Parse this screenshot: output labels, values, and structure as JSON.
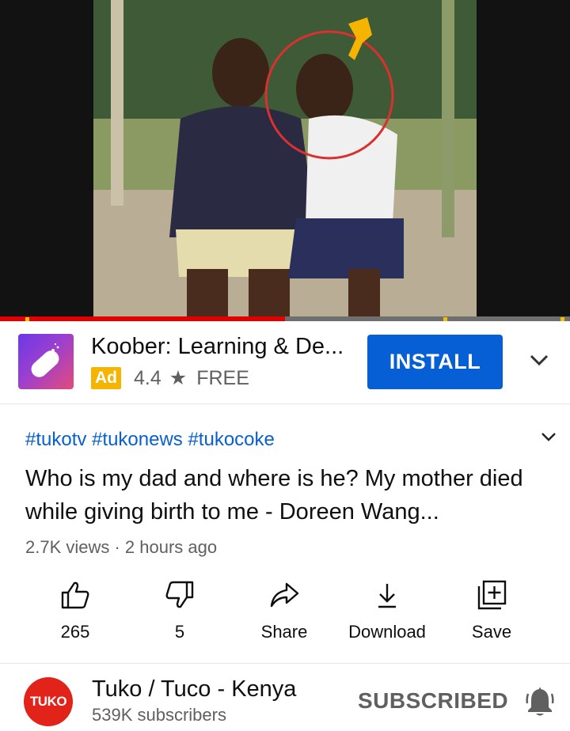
{
  "ad": {
    "title": "Koober: Learning & De...",
    "badge": "Ad",
    "rating": "4.4",
    "price": "FREE",
    "install_label": "INSTALL",
    "brand_color": "#065fd4"
  },
  "video": {
    "progress_fraction": 0.5,
    "hashtags": "#tukotv #tukonews #tukocoke",
    "title": "Who is my dad and where is he? My mother died while giving birth to me - Doreen Wang...",
    "meta": "2.7K views · 2 hours ago"
  },
  "actions": [
    {
      "label": "265",
      "icon": "thumbs-up-icon"
    },
    {
      "label": "5",
      "icon": "thumbs-down-icon"
    },
    {
      "label": "Share",
      "icon": "share-icon"
    },
    {
      "label": "Download",
      "icon": "download-icon"
    },
    {
      "label": "Save",
      "icon": "save-icon"
    }
  ],
  "channel": {
    "logo_text": "TUKO",
    "name": "Tuko / Tuco - Kenya",
    "subscribers": "539K subscribers",
    "subscribe_label": "SUBSCRIBED",
    "logo_color": "#e2231a"
  }
}
